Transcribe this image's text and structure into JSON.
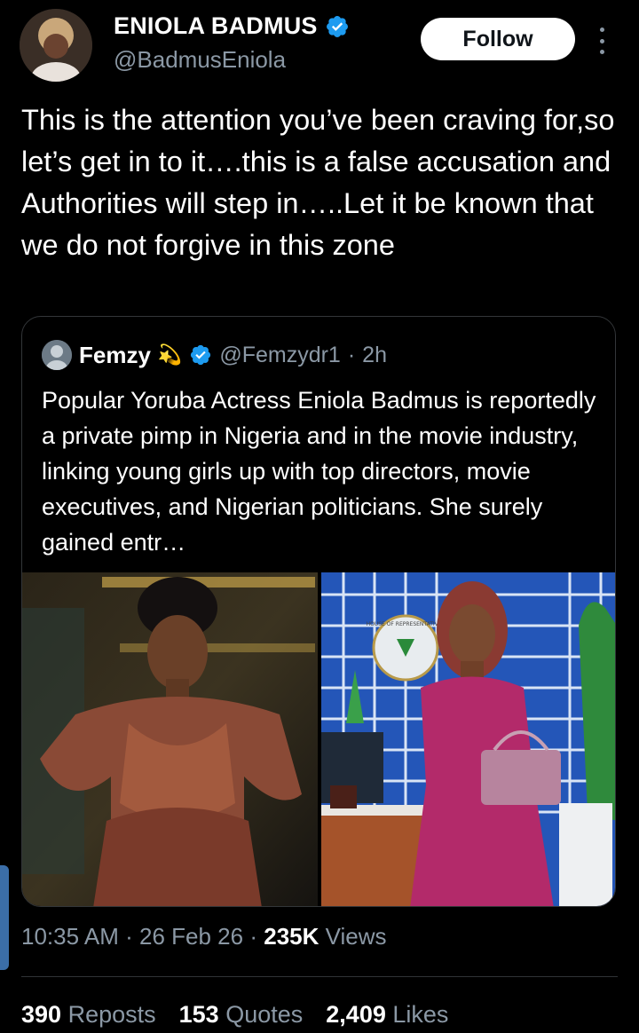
{
  "author": {
    "name": "ENIOLA BADMUS",
    "handle": "@BadmusEniola",
    "follow_label": "Follow"
  },
  "tweet": {
    "text": "This is the attention you’ve been craving for,so let’s get in to it….this is a false accusation and Authorities will step in…..Let it be known that we do not forgive in this zone"
  },
  "quoted": {
    "name": "Femzy",
    "name_emoji": "💫",
    "handle": "@Femzydr1",
    "separator": "·",
    "time": "2h",
    "text": "Popular Yoruba Actress Eniola Badmus is reportedly a private pimp in Nigeria and in the movie industry, linking young girls up with top directors, movie executives, and Nigerian politicians. She surely gained entr…",
    "seal_text": "HOUSE OF REPRESENTATIVES"
  },
  "meta": {
    "time": "10:35 AM",
    "sep1": "·",
    "date": "26 Feb 26",
    "sep2": "·",
    "views_count": "235K",
    "views_label": "Views"
  },
  "stats": {
    "reposts_count": "390",
    "reposts_label": "Reposts",
    "quotes_count": "153",
    "quotes_label": "Quotes",
    "likes_count": "2,409",
    "likes_label": "Likes"
  },
  "colors": {
    "background": "#000000",
    "verified": "#1d9bf0",
    "muted": "#8b98a5"
  },
  "icons": [
    "verified-badge-icon",
    "more-options-icon"
  ]
}
